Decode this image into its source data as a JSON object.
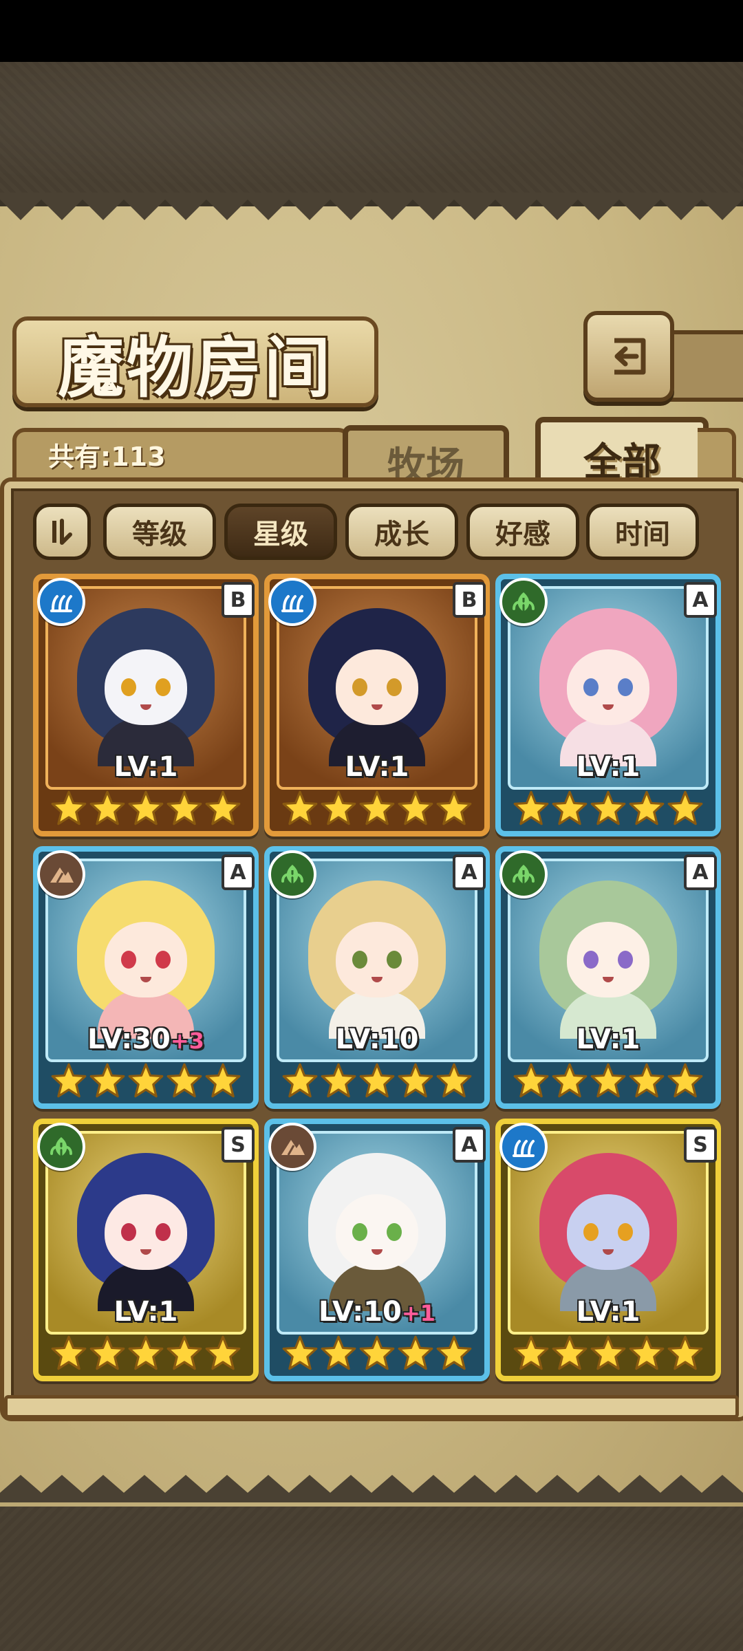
{
  "page": {
    "title": "魔物房间"
  },
  "header": {
    "count_label": "共有:113"
  },
  "tabs": [
    {
      "label": "牧场",
      "active": false
    },
    {
      "label": "全部",
      "active": true
    }
  ],
  "sort": {
    "icon": "sort-order-icon",
    "options": [
      {
        "label": "等级",
        "active": false
      },
      {
        "label": "星级",
        "active": true
      },
      {
        "label": "成长",
        "active": false
      },
      {
        "label": "好感",
        "active": false
      },
      {
        "label": "时间",
        "active": false
      }
    ]
  },
  "colors": {
    "frame_orange": "#e29a3a",
    "frame_blue": "#5cc0e8",
    "frame_gold": "#f0d03a",
    "water": "#1d78c9",
    "nature": "#2f6a2a",
    "earth": "#6a4a36",
    "bonus_pink": "#ff5c9a",
    "star": "#ffd43a"
  },
  "monsters": [
    {
      "level": "LV:1",
      "bonus": "",
      "rank": "B",
      "element": "water",
      "frame": "orange",
      "stars": 5,
      "hair": "#2d3a5e",
      "eyes": "#e0a020",
      "outfit": "#2b2b3a",
      "skin": "#f4f4f8"
    },
    {
      "level": "LV:1",
      "bonus": "",
      "rank": "B",
      "element": "water",
      "frame": "orange",
      "stars": 5,
      "hair": "#1f2448",
      "eyes": "#d39a2a",
      "outfit": "#1e1e30",
      "skin": "#fde9dc"
    },
    {
      "level": "LV:1",
      "bonus": "",
      "rank": "A",
      "element": "nature",
      "frame": "blue",
      "stars": 5,
      "hair": "#f0a6bf",
      "eyes": "#5a7ec8",
      "outfit": "#f6dfe4",
      "skin": "#fde9e4"
    },
    {
      "level": "LV:30",
      "bonus": "+3",
      "rank": "A",
      "element": "earth",
      "frame": "blue",
      "stars": 5,
      "hair": "#f6dc6e",
      "eyes": "#d03a4a",
      "outfit": "#f4b6b6",
      "skin": "#fde9dc"
    },
    {
      "level": "LV:10",
      "bonus": "",
      "rank": "A",
      "element": "nature",
      "frame": "blue",
      "stars": 5,
      "hair": "#e8cf8e",
      "eyes": "#6a8a3a",
      "outfit": "#f4f0e8",
      "skin": "#fde9dc"
    },
    {
      "level": "LV:1",
      "bonus": "",
      "rank": "A",
      "element": "nature",
      "frame": "blue",
      "stars": 5,
      "hair": "#a8c89a",
      "eyes": "#8a6ac8",
      "outfit": "#d6e8d0",
      "skin": "#fdf0e6"
    },
    {
      "level": "LV:1",
      "bonus": "",
      "rank": "S",
      "element": "nature",
      "frame": "gold",
      "stars": 5,
      "hair": "#2c3a8a",
      "eyes": "#c0304a",
      "outfit": "#1a1a2a",
      "skin": "#fde9e4"
    },
    {
      "level": "LV:10",
      "bonus": "+1",
      "rank": "A",
      "element": "earth",
      "frame": "blue",
      "stars": 5,
      "hair": "#f2f2f2",
      "eyes": "#6ab04a",
      "outfit": "#6a5a3a",
      "skin": "#fbf6f2"
    },
    {
      "level": "LV:1",
      "bonus": "",
      "rank": "S",
      "element": "water",
      "frame": "gold",
      "stars": 5,
      "hair": "#d84a6a",
      "eyes": "#e6a020",
      "outfit": "#8a9aa8",
      "skin": "#c8d0f0"
    }
  ]
}
